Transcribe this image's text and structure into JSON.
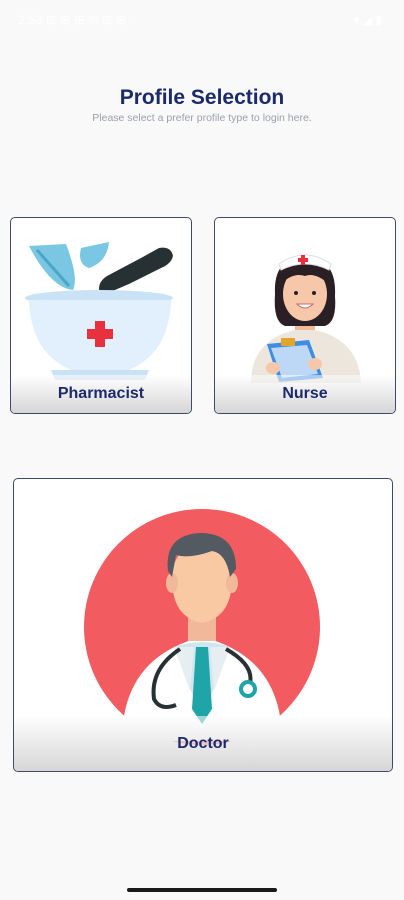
{
  "status_bar": {
    "left_text": "2:53 ⊞ ⊞ ⊞ ✉ ⊞ ⊞ ·",
    "right_text": "▾ ◢ ▮"
  },
  "header": {
    "title": "Profile Selection",
    "subtitle": "Please select a prefer profile type to login here."
  },
  "profiles": [
    {
      "label": "Pharmacist",
      "icon": "mortar-pestle-icon"
    },
    {
      "label": "Nurse",
      "icon": "nurse-avatar-icon"
    },
    {
      "label": "Doctor",
      "icon": "doctor-avatar-icon"
    }
  ],
  "colors": {
    "title": "#1b2a6b",
    "card_border": "#3d4a6b",
    "doctor_circle": "#f25b5f",
    "medical_cross": "#e8303f"
  }
}
